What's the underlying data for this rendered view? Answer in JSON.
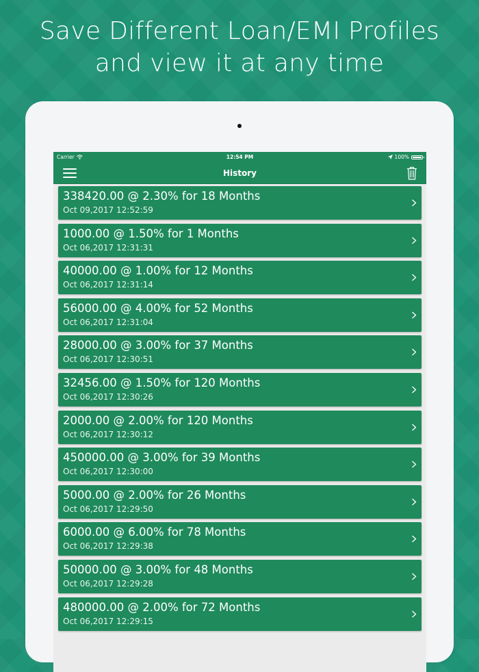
{
  "headline": {
    "line1": "Save Different Loan/EMI Profiles",
    "line2": "and view it at any time"
  },
  "status_bar": {
    "carrier": "Carrier",
    "time": "12:54 PM",
    "battery": "100%"
  },
  "nav": {
    "title": "History",
    "menu_icon": "hamburger-menu-icon",
    "delete_icon": "trash-icon"
  },
  "colors": {
    "background": "#1f9477",
    "bar": "#1f8a5c",
    "row": "#1f8a5c"
  },
  "history": [
    {
      "title": "338420.00 @ 2.30% for 18 Months",
      "date": "Oct 09,2017 12:52:59"
    },
    {
      "title": "1000.00 @ 1.50% for 1 Months",
      "date": "Oct 06,2017 12:31:31"
    },
    {
      "title": "40000.00 @ 1.00% for 12 Months",
      "date": "Oct 06,2017 12:31:14"
    },
    {
      "title": "56000.00 @ 4.00% for 52 Months",
      "date": "Oct 06,2017 12:31:04"
    },
    {
      "title": "28000.00 @ 3.00% for 37 Months",
      "date": "Oct 06,2017 12:30:51"
    },
    {
      "title": "32456.00 @ 1.50% for 120 Months",
      "date": "Oct 06,2017 12:30:26"
    },
    {
      "title": "2000.00 @ 2.00% for 120 Months",
      "date": "Oct 06,2017 12:30:12"
    },
    {
      "title": "450000.00 @ 3.00% for 39 Months",
      "date": "Oct 06,2017 12:30:00"
    },
    {
      "title": "5000.00 @ 2.00% for 26 Months",
      "date": "Oct 06,2017 12:29:50"
    },
    {
      "title": "6000.00 @ 6.00% for 78 Months",
      "date": "Oct 06,2017 12:29:38"
    },
    {
      "title": "50000.00 @ 3.00% for 48 Months",
      "date": "Oct 06,2017 12:29:28"
    },
    {
      "title": "480000.00 @ 2.00% for 72 Months",
      "date": "Oct 06,2017 12:29:15"
    }
  ]
}
